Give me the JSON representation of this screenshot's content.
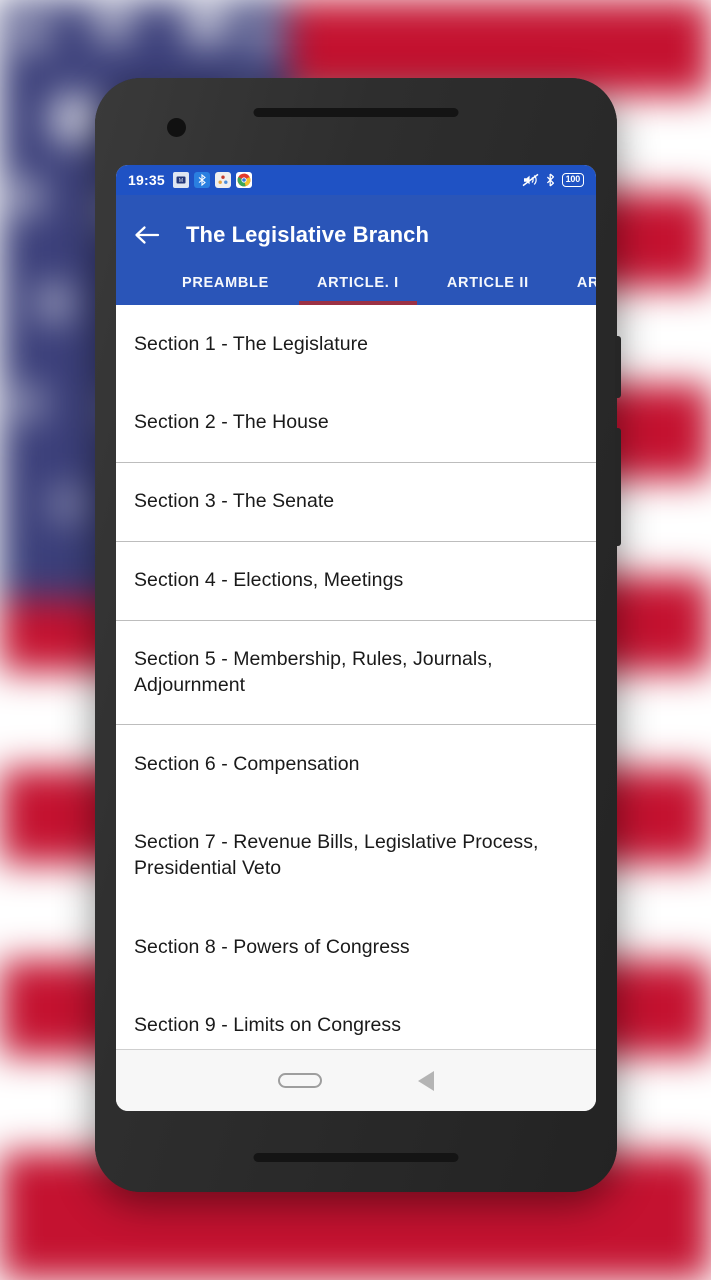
{
  "background": {
    "description": "blurred-american-flag",
    "colors": {
      "red": "#c41230",
      "white": "#ffffff",
      "canton_blue": "#3b3f7a"
    }
  },
  "device": {
    "name": "android-phone-mockup",
    "frame_color": "#2b2b2b",
    "buttons": [
      "power",
      "volume"
    ]
  },
  "status_bar": {
    "time": "19:35",
    "left_icons": [
      {
        "name": "notification-app-icon",
        "glyph": "▣"
      },
      {
        "name": "bluetooth-notification-icon",
        "glyph": "✶"
      },
      {
        "name": "files-app-icon",
        "glyph": "▲"
      },
      {
        "name": "chrome-icon",
        "glyph": "◉"
      }
    ],
    "right_icons": [
      {
        "name": "vibrate-mute-icon",
        "glyph": "🔇"
      },
      {
        "name": "bluetooth-icon",
        "glyph": "ᛗ"
      }
    ],
    "battery_level": "100",
    "background": "#1f52c4"
  },
  "app_bar": {
    "back_button_label": "Back",
    "title": "The Legislative Branch",
    "background": "#2a55b8",
    "accent": "#a03040",
    "tabs": [
      {
        "label": "PREAMBLE",
        "selected": false
      },
      {
        "label": "ARTICLE. I",
        "selected": true
      },
      {
        "label": "ARTICLE II",
        "selected": false
      },
      {
        "label": "ARTICLE III",
        "selected": false
      }
    ]
  },
  "section_list": {
    "items": [
      {
        "label": "Section 1 - The Legislature",
        "divider": false
      },
      {
        "label": "Section 2 - The House",
        "divider": true
      },
      {
        "label": "Section 3 - The Senate",
        "divider": true
      },
      {
        "label": "Section 4 - Elections, Meetings",
        "divider": true
      },
      {
        "label": "Section 5 - Membership, Rules, Journals, Adjournment",
        "divider": true
      },
      {
        "label": "Section 6 - Compensation",
        "divider": false
      },
      {
        "label": "Section 7 - Revenue Bills, Legislative Process, Presidential Veto",
        "divider": false
      },
      {
        "label": "Section 8 - Powers of Congress",
        "divider": false
      },
      {
        "label": "Section 9 - Limits on Congress",
        "divider": true
      }
    ]
  },
  "nav_bar": {
    "home_label": "Home",
    "back_label": "Back"
  }
}
